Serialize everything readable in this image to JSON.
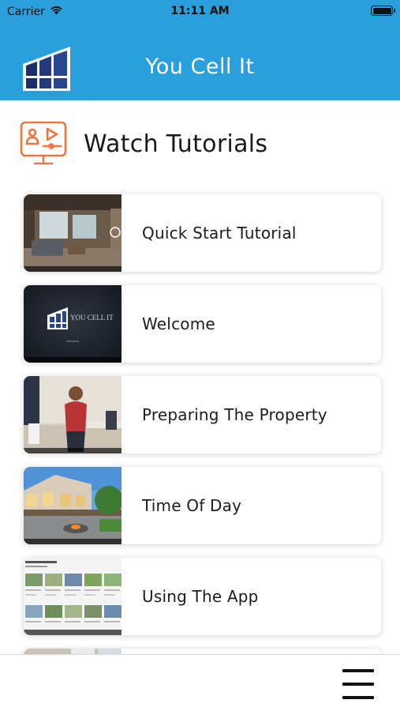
{
  "status_bar": {
    "carrier": "Carrier",
    "time": "11:11 AM"
  },
  "header": {
    "title": "You Cell It",
    "logo_icon": "window-logo-icon",
    "bg_color": "#2a9fdb"
  },
  "section": {
    "title": "Watch Tutorials",
    "icon": "tutorial-screen-icon",
    "accent": "#f0743e"
  },
  "tutorials": [
    {
      "label": "Quick Start Tutorial"
    },
    {
      "label": "Welcome",
      "thumb_text": "YOU CELL IT"
    },
    {
      "label": "Preparing The Property"
    },
    {
      "label": "Time Of Day"
    },
    {
      "label": "Using The App"
    }
  ],
  "bottom_bar": {
    "menu_icon": "hamburger-menu-icon"
  }
}
